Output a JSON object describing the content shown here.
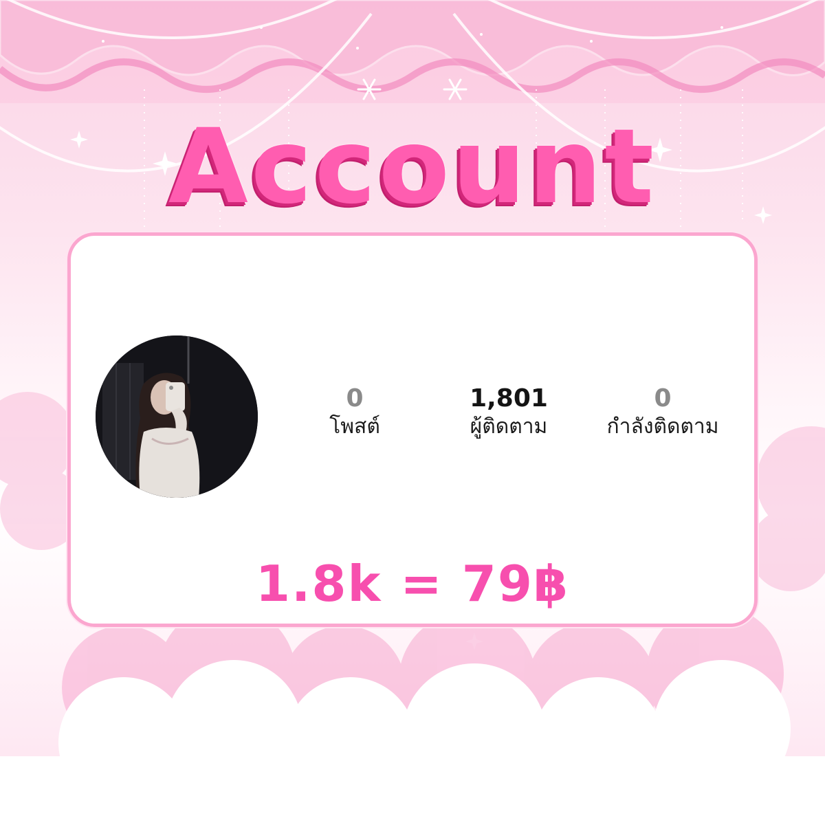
{
  "title": "Account",
  "stats": [
    {
      "value": "0",
      "label": "โพสต์"
    },
    {
      "value": "1,801",
      "label": "ผู้ติดตาม"
    },
    {
      "value": "0",
      "label": "กำลังติดตาม"
    }
  ],
  "price": "1.8k = 79฿",
  "colors": {
    "accent": "#ff5db0",
    "accent_dark": "#d2277a",
    "card_border": "#fba6cf",
    "price": "#f74fae",
    "background_top": "#fbd3e6",
    "background_mid": "#ffffff"
  },
  "avatar": {
    "icon": "profile-photo"
  }
}
